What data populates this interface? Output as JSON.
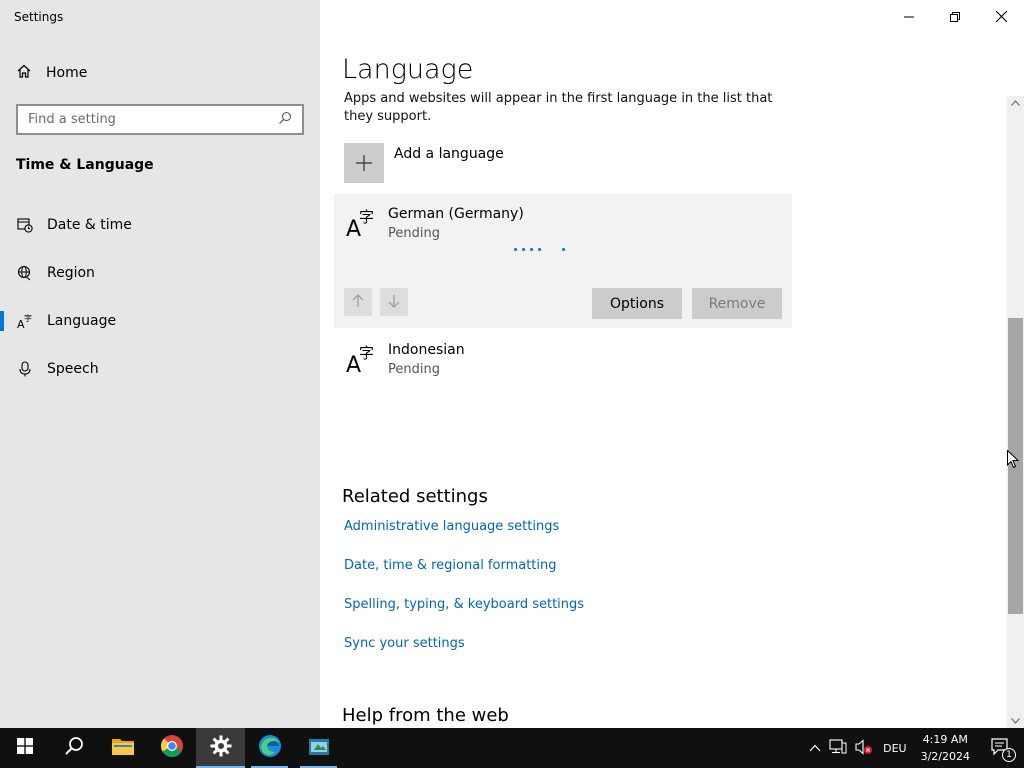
{
  "window": {
    "title": "Settings",
    "controls": {
      "minimize": "minimize",
      "maximize": "restore",
      "close": "close"
    }
  },
  "sidebar": {
    "home_label": "Home",
    "search_placeholder": "Find a setting",
    "section_title": "Time & Language",
    "items": [
      {
        "label": "Date & time",
        "icon": "calendar-clock-icon",
        "active": false
      },
      {
        "label": "Region",
        "icon": "globe-icon",
        "active": false
      },
      {
        "label": "Language",
        "icon": "language-icon",
        "active": true
      },
      {
        "label": "Speech",
        "icon": "microphone-icon",
        "active": false
      }
    ]
  },
  "main": {
    "page_title": "Language",
    "description": "Apps and websites will appear in the first language in the list that they support.",
    "add_language_label": "Add a language",
    "languages": [
      {
        "name": "German (Germany)",
        "status": "Pending",
        "selected": true
      },
      {
        "name": "Indonesian",
        "status": "Pending",
        "selected": false
      }
    ],
    "buttons": {
      "options": "Options",
      "remove": "Remove"
    },
    "related_settings_title": "Related settings",
    "related_links": [
      "Administrative language settings",
      "Date, time & regional formatting",
      "Spelling, typing, & keyboard settings",
      "Sync your settings"
    ],
    "help_title": "Help from the web"
  },
  "taskbar": {
    "apps": [
      "start",
      "search",
      "file-explorer",
      "chrome",
      "settings",
      "edge",
      "app"
    ],
    "language_indicator": "DEU",
    "time": "4:19 AM",
    "date": "3/2/2024",
    "notification_count": "1"
  },
  "colors": {
    "accent": "#0078d7",
    "link": "#0066b4",
    "sidebar_bg": "#e6e6e6",
    "taskbar_bg": "#101010"
  }
}
